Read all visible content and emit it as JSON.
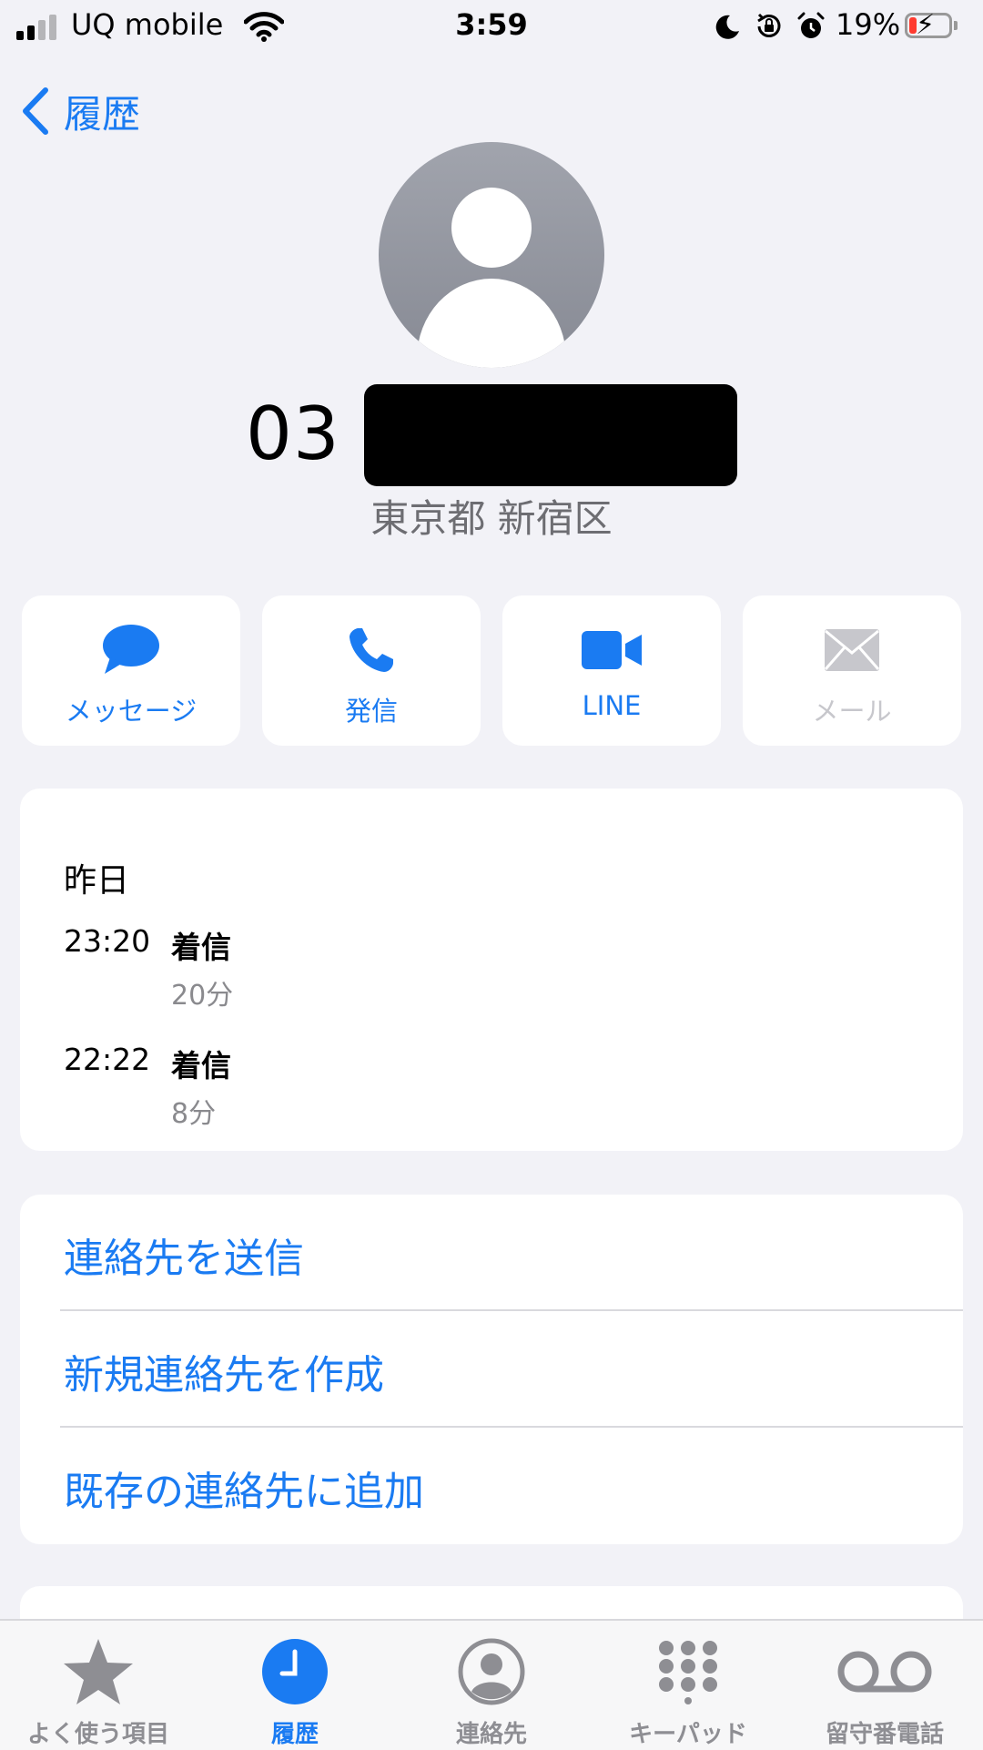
{
  "status_bar": {
    "carrier": "UQ mobile",
    "time": "3:59",
    "battery_percent": "19%",
    "battery_level": 0.19,
    "battery_color": "#ff3b30",
    "signal_bars_filled": 2,
    "icons": [
      "cellular-signal-icon",
      "wifi-icon",
      "moon-icon",
      "rotation-lock-icon",
      "alarm-icon",
      "battery-charging-icon"
    ]
  },
  "nav": {
    "back_label": "履歴",
    "back_icon": "chevron-left-icon"
  },
  "contact": {
    "avatar_icon": "person-silhouette-icon",
    "phone_prefix": "03",
    "location": "東京都 新宿区"
  },
  "actions": [
    {
      "label": "メッセージ",
      "icon": "message-bubble-icon",
      "enabled": true
    },
    {
      "label": "発信",
      "icon": "phone-icon",
      "enabled": true
    },
    {
      "label": "LINE",
      "icon": "video-camera-icon",
      "enabled": true
    },
    {
      "label": "メール",
      "icon": "envelope-icon",
      "enabled": false
    }
  ],
  "history": {
    "date": "昨日",
    "entries": [
      {
        "time": "23:20",
        "type": "着信",
        "duration": "20分"
      },
      {
        "time": "22:22",
        "type": "着信",
        "duration": "8分"
      }
    ]
  },
  "options": [
    {
      "label": "連絡先を送信"
    },
    {
      "label": "新規連絡先を作成"
    },
    {
      "label": "既存の連絡先に追加"
    }
  ],
  "tabs": [
    {
      "label": "よく使う項目",
      "icon": "star-icon",
      "active": false
    },
    {
      "label": "履歴",
      "icon": "clock-icon",
      "active": true
    },
    {
      "label": "連絡先",
      "icon": "person-circle-icon",
      "active": false
    },
    {
      "label": "キーパッド",
      "icon": "keypad-icon",
      "active": false
    },
    {
      "label": "留守番電話",
      "icon": "voicemail-icon",
      "active": false
    }
  ],
  "colors": {
    "accent": "#1a7bf2",
    "background": "#f2f2f7",
    "secondary_text": "#6d6d72"
  }
}
